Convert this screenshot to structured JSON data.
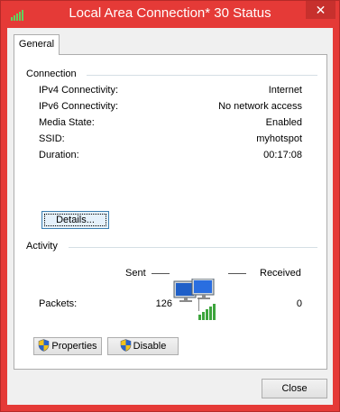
{
  "window": {
    "title": "Local Area Connection* 30 Status",
    "close_glyph": "✕"
  },
  "tabs": [
    {
      "label": "General"
    }
  ],
  "connection": {
    "group_label": "Connection",
    "rows": [
      {
        "label": "IPv4 Connectivity:",
        "value": "Internet"
      },
      {
        "label": "IPv6 Connectivity:",
        "value": "No network access"
      },
      {
        "label": "Media State:",
        "value": "Enabled"
      },
      {
        "label": "SSID:",
        "value": "myhotspot"
      },
      {
        "label": "Duration:",
        "value": "00:17:08"
      }
    ],
    "details_label": "Details..."
  },
  "activity": {
    "group_label": "Activity",
    "sent_label": "Sent",
    "received_label": "Received",
    "packets_label": "Packets:",
    "packets_sent": "126",
    "packets_received": "0"
  },
  "buttons": {
    "properties": "Properties",
    "disable": "Disable",
    "close": "Close"
  },
  "icons": {
    "title": "wifi-signal-icon",
    "activity": "network-computer-icon",
    "uac": "uac-shield-icon"
  },
  "colors": {
    "titlebar": "#e53a37",
    "accent_green": "#3da53d"
  }
}
